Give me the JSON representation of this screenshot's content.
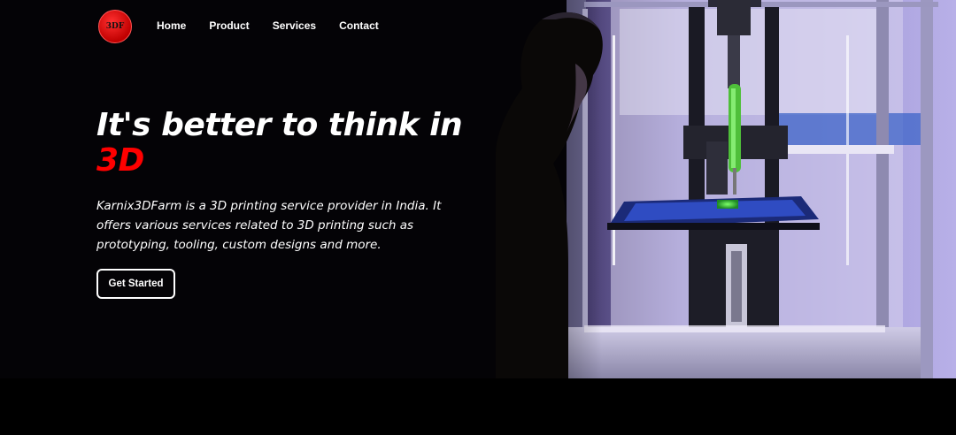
{
  "brand": {
    "logo_text": "3DF"
  },
  "nav": {
    "items": [
      {
        "label": "Home"
      },
      {
        "label": "Product"
      },
      {
        "label": "Services"
      },
      {
        "label": "Contact"
      }
    ]
  },
  "hero": {
    "headline_line1": "It's better to think in",
    "headline_accent": "3D",
    "description": "Karnix3DFarm is a 3D printing service provider in India. It offers various services related to 3D printing such as prototyping, tooling, custom designs and more.",
    "cta_label": "Get Started"
  },
  "colors": {
    "accent": "#ff0000",
    "background": "#040306",
    "light_purple": "#b7a8f0"
  }
}
